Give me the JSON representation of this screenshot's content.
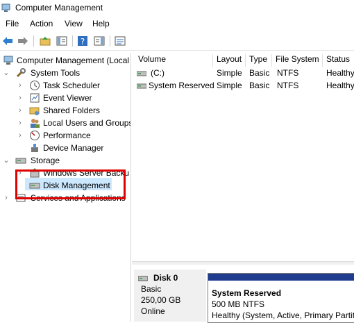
{
  "window": {
    "title": "Computer Management"
  },
  "menu": {
    "items": [
      "File",
      "Action",
      "View",
      "Help"
    ]
  },
  "tree": {
    "root": "Computer Management (Local",
    "system_tools": "System Tools",
    "task_scheduler": "Task Scheduler",
    "event_viewer": "Event Viewer",
    "shared_folders": "Shared Folders",
    "local_users": "Local Users and Groups",
    "performance": "Performance",
    "device_manager": "Device Manager",
    "storage": "Storage",
    "windows_server_backup": "Windows Server Backu",
    "disk_management": "Disk Management",
    "services": "Services and Applications"
  },
  "list": {
    "columns": [
      "Volume",
      "Layout",
      "Type",
      "File System",
      "Status"
    ],
    "rows": [
      {
        "volume": "(C:)",
        "layout": "Simple",
        "type": "Basic",
        "fs": "NTFS",
        "status": "Healthy"
      },
      {
        "volume": "System Reserved",
        "layout": "Simple",
        "type": "Basic",
        "fs": "NTFS",
        "status": "Healthy"
      }
    ]
  },
  "disk": {
    "name": "Disk 0",
    "type": "Basic",
    "size": "250,00 GB",
    "state": "Online",
    "partition": {
      "name": "System Reserved",
      "size": "500 MB NTFS",
      "status": "Healthy (System, Active, Primary Partit"
    }
  },
  "colors": {
    "highlight_box": "#e00000",
    "selection": "#cce8ff",
    "partition_band": "#1f3c8f"
  }
}
